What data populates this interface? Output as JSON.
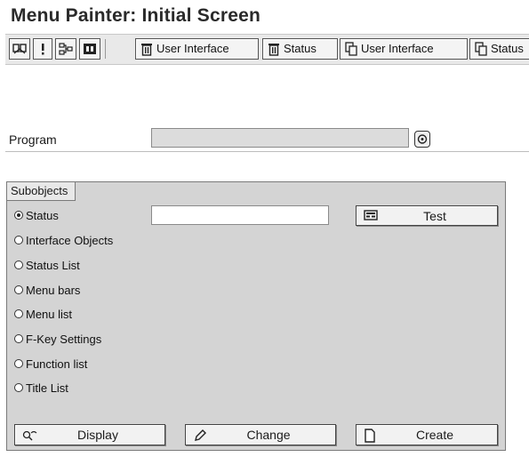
{
  "page": {
    "title": "Menu Painter: Initial Screen"
  },
  "toolbar": {
    "buttons": [
      {
        "label": "User Interface",
        "icon": "delete-icon"
      },
      {
        "label": "Status",
        "icon": "delete-icon"
      },
      {
        "label": "User Interface",
        "icon": "copy-icon"
      },
      {
        "label": "Status",
        "icon": "copy-icon"
      }
    ],
    "icons": [
      "where-used-icon",
      "info-icon",
      "hierarchy-icon",
      "display-object-icon"
    ]
  },
  "program": {
    "label": "Program",
    "value": ""
  },
  "subobjects": {
    "title": "Subobjects",
    "status_value": "",
    "test_label": "Test",
    "options": [
      {
        "label": "Status",
        "selected": true
      },
      {
        "label": "Interface Objects",
        "selected": false
      },
      {
        "label": "Status List",
        "selected": false
      },
      {
        "label": "Menu bars",
        "selected": false
      },
      {
        "label": "Menu list",
        "selected": false
      },
      {
        "label": "F-Key Settings",
        "selected": false
      },
      {
        "label": "Function list",
        "selected": false
      },
      {
        "label": "Title List",
        "selected": false
      }
    ]
  },
  "actions": {
    "display": "Display",
    "change": "Change",
    "create": "Create"
  }
}
